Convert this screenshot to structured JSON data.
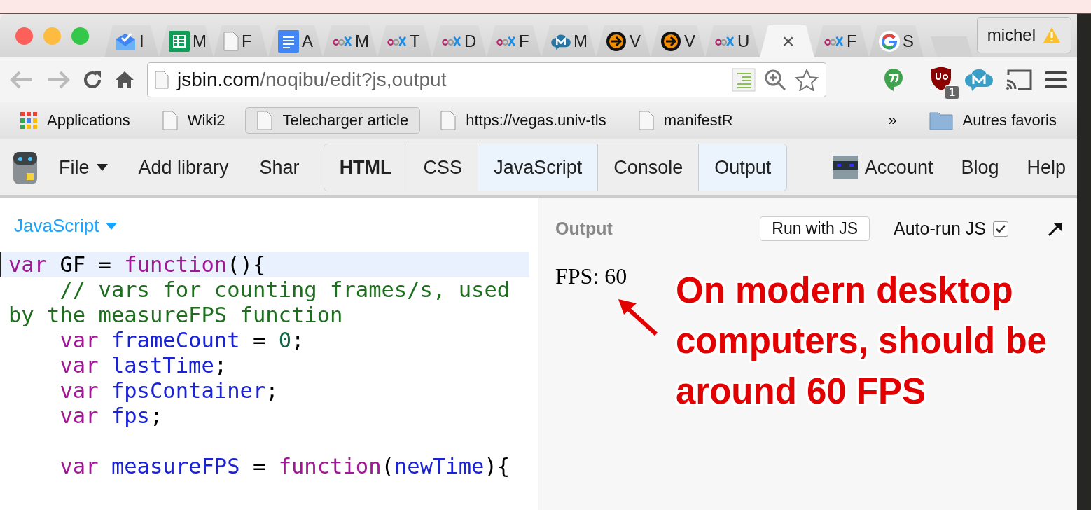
{
  "browser": {
    "tabs": [
      {
        "kind": "inbox",
        "label": "I",
        "selected": false
      },
      {
        "kind": "sheets",
        "label": "M",
        "selected": false
      },
      {
        "kind": "page",
        "label": "F",
        "selected": false
      },
      {
        "kind": "docs",
        "label": "A",
        "selected": false
      },
      {
        "kind": "edx",
        "label": "M",
        "selected": false
      },
      {
        "kind": "edx",
        "label": "T",
        "selected": false
      },
      {
        "kind": "edx",
        "label": "D",
        "selected": false
      },
      {
        "kind": "edx",
        "label": "F",
        "selected": false
      },
      {
        "kind": "cloud",
        "label": "M",
        "selected": false
      },
      {
        "kind": "arrow",
        "label": "V",
        "selected": false
      },
      {
        "kind": "arrow",
        "label": "V",
        "selected": false
      },
      {
        "kind": "edx",
        "label": "U",
        "selected": false
      },
      {
        "kind": "blank",
        "close": "×",
        "selected": true
      },
      {
        "kind": "edx",
        "label": "F",
        "selected": false
      },
      {
        "kind": "google",
        "label": "S",
        "selected": false
      }
    ],
    "profile": "michel",
    "url": {
      "host": "jsbin.com",
      "path": "/noqibu/edit?js,output"
    },
    "extension_badge": "1",
    "bookmarks": [
      {
        "kind": "apps",
        "label": "Applications",
        "selected": false
      },
      {
        "kind": "page",
        "label": "Wiki2",
        "selected": false
      },
      {
        "kind": "page",
        "label": "Telecharger article",
        "selected": true
      },
      {
        "kind": "page",
        "label": "https://vegas.univ-tls",
        "selected": false
      },
      {
        "kind": "page",
        "label": "manifestR",
        "selected": false
      }
    ],
    "bookmarks_overflow": "»",
    "other_bookmarks": "Autres favoris"
  },
  "jsbin": {
    "menu": [
      {
        "label": "File",
        "dropdown": true
      },
      {
        "label": "Add library",
        "dropdown": false
      },
      {
        "label": "Shar",
        "dropdown": false
      }
    ],
    "panels": [
      {
        "label": "HTML",
        "selected": false,
        "bold": true
      },
      {
        "label": "CSS",
        "selected": false,
        "bold": false
      },
      {
        "label": "JavaScript",
        "selected": true,
        "bold": false
      },
      {
        "label": "Console",
        "selected": false,
        "bold": false
      },
      {
        "label": "Output",
        "selected": true,
        "bold": false
      }
    ],
    "links": [
      "Account",
      "Blog",
      "Help"
    ]
  },
  "editor": {
    "language": "JavaScript",
    "lines": [
      {
        "active": true,
        "indent": false,
        "gap_before": false,
        "tokens": [
          {
            "kind": "keyword",
            "text": "var"
          },
          {
            "kind": "plain",
            "text": " GF = "
          },
          {
            "kind": "keyword",
            "text": "function"
          },
          {
            "kind": "plain",
            "text": "(){"
          }
        ]
      },
      {
        "active": false,
        "indent": true,
        "gap_before": false,
        "tokens": [
          {
            "kind": "comment",
            "text": "// vars for counting frames/s, used by the measureFPS function"
          }
        ]
      },
      {
        "active": false,
        "indent": true,
        "gap_before": false,
        "tokens": [
          {
            "kind": "keyword",
            "text": "var"
          },
          {
            "kind": "variable",
            "text": " frameCount"
          },
          {
            "kind": "plain",
            "text": " = "
          },
          {
            "kind": "number",
            "text": "0"
          },
          {
            "kind": "plain",
            "text": ";"
          }
        ]
      },
      {
        "active": false,
        "indent": true,
        "gap_before": false,
        "tokens": [
          {
            "kind": "keyword",
            "text": "var"
          },
          {
            "kind": "variable",
            "text": " lastTime"
          },
          {
            "kind": "plain",
            "text": ";"
          }
        ]
      },
      {
        "active": false,
        "indent": true,
        "gap_before": false,
        "tokens": [
          {
            "kind": "keyword",
            "text": "var"
          },
          {
            "kind": "variable",
            "text": " fpsContainer"
          },
          {
            "kind": "plain",
            "text": ";"
          }
        ]
      },
      {
        "active": false,
        "indent": true,
        "gap_before": false,
        "tokens": [
          {
            "kind": "keyword",
            "text": "var"
          },
          {
            "kind": "variable",
            "text": " fps"
          },
          {
            "kind": "plain",
            "text": ";"
          }
        ]
      },
      {
        "active": false,
        "indent": true,
        "gap_before": true,
        "tokens": [
          {
            "kind": "keyword",
            "text": "var"
          },
          {
            "kind": "variable",
            "text": " measureFPS"
          },
          {
            "kind": "plain",
            "text": " = "
          },
          {
            "kind": "keyword",
            "text": "function"
          },
          {
            "kind": "plain",
            "text": "("
          },
          {
            "kind": "variable",
            "text": "newTime"
          },
          {
            "kind": "plain",
            "text": "){"
          }
        ]
      }
    ]
  },
  "output": {
    "title": "Output",
    "run_button": "Run with JS",
    "autorun": {
      "label": "Auto-run JS",
      "checked": true
    },
    "text": "FPS: 60"
  },
  "annotation": {
    "text": "On modern desktop computers, should be around 60 FPS"
  }
}
